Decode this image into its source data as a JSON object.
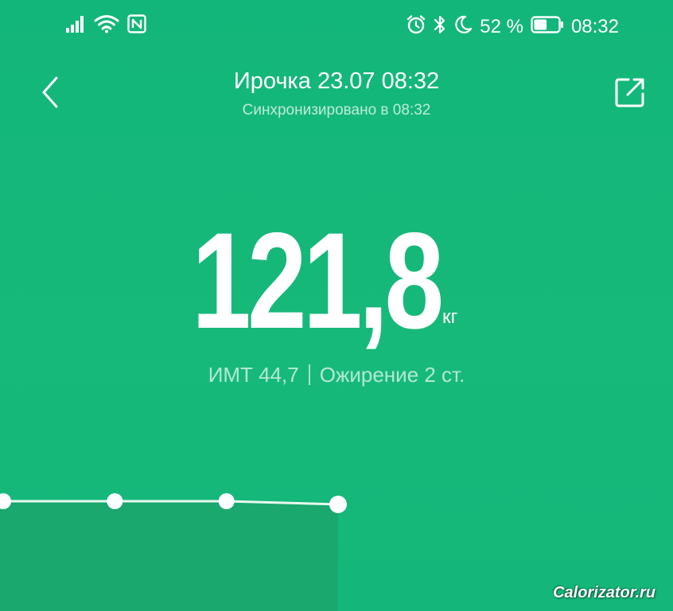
{
  "status_bar": {
    "battery_percent": "52 %",
    "battery_level": 0.52,
    "time": "08:32",
    "icons": [
      "signal-icon",
      "wifi-icon",
      "nfc-icon",
      "alarm-icon",
      "bluetooth-icon",
      "moon-icon",
      "battery-icon"
    ]
  },
  "header": {
    "title": "Ирочка 23.07 08:32",
    "sync_status": "Синхронизировано в 08:32",
    "back_icon": "chevron-left-icon",
    "share_icon": "share-icon"
  },
  "measurement": {
    "weight": "121,8",
    "unit": "кг",
    "bmi": "ИМТ 44,7",
    "category": "Ожирение 2 ст."
  },
  "chart_data": {
    "type": "line",
    "points": [
      {
        "index": 0,
        "value": 121.8
      },
      {
        "index": 1,
        "value": 121.8
      },
      {
        "index": 2,
        "value": 121.8
      },
      {
        "index": 3,
        "value": 121.7
      }
    ],
    "xlim": [
      0,
      6
    ],
    "ylim": [
      120.8,
      122.8
    ],
    "selected_index": 3,
    "line_color": "#e8f8f0",
    "fill_color": "#1aa86f"
  },
  "watermark": "Calorizator.ru",
  "colors": {
    "background": "#16b87a",
    "text": "#ffffff"
  }
}
